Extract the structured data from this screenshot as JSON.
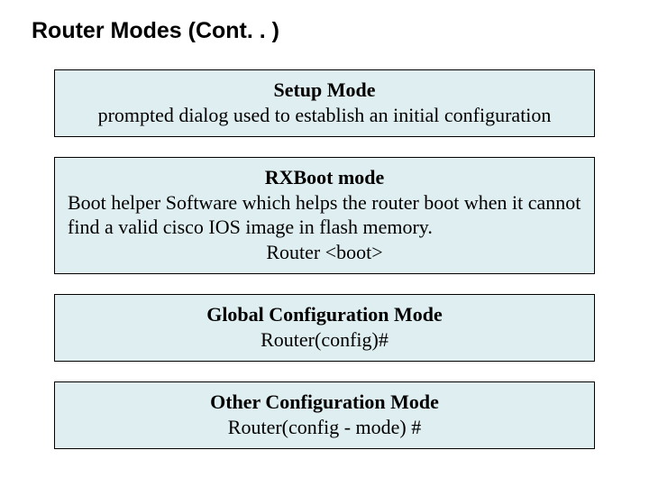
{
  "title": "Router Modes (Cont. . )",
  "boxes": [
    {
      "heading": "Setup Mode",
      "body": "prompted dialog used to establish an initial configuration",
      "prompt": "",
      "bodyAlign": "center"
    },
    {
      "heading": "RXBoot mode",
      "body": "Boot helper Software which helps the router boot when it cannot find a valid cisco IOS image in flash memory.",
      "prompt": "Router <boot>",
      "bodyAlign": "left"
    },
    {
      "heading": "Global Configuration Mode",
      "body": "",
      "prompt": "Router(config)#",
      "bodyAlign": "center"
    },
    {
      "heading": "Other Configuration Mode",
      "body": "",
      "prompt": "Router(config - mode) #",
      "bodyAlign": "center"
    }
  ]
}
